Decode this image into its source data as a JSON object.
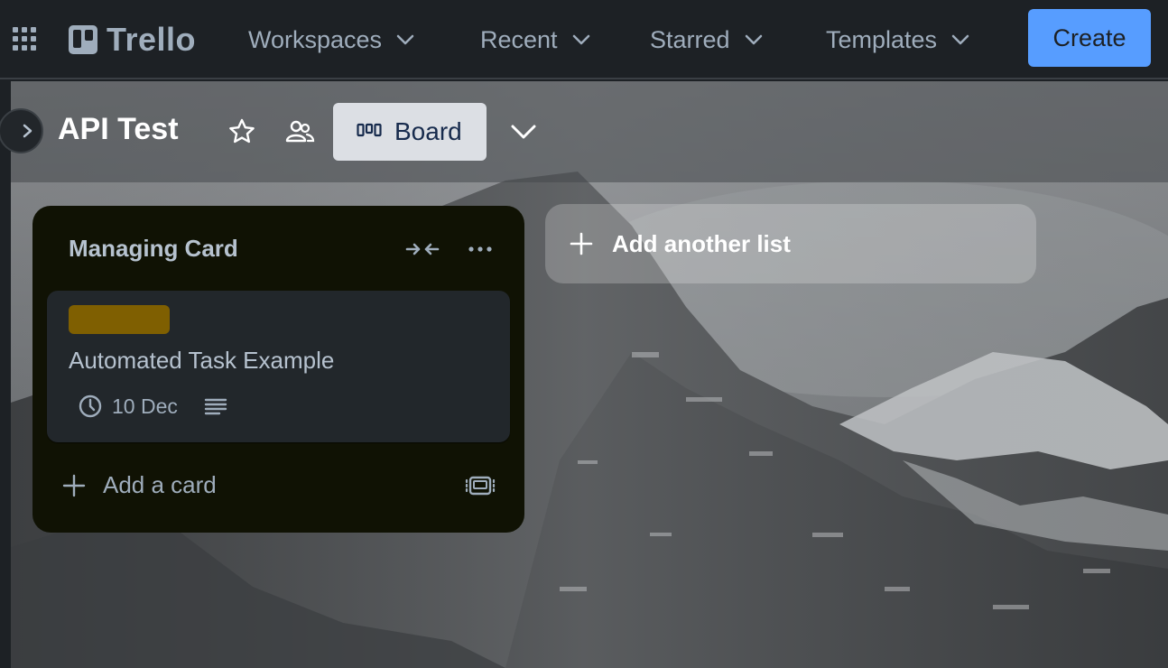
{
  "app": {
    "logo_text": "Trello"
  },
  "nav": {
    "items": [
      {
        "label": "Workspaces"
      },
      {
        "label": "Recent"
      },
      {
        "label": "Starred"
      },
      {
        "label": "Templates"
      }
    ],
    "create_label": "Create"
  },
  "board": {
    "title": "API Test",
    "view_label": "Board",
    "add_list_label": "Add another list",
    "lists": [
      {
        "title": "Managing Card",
        "add_card_label": "Add a card",
        "cards": [
          {
            "title": "Automated Task Example",
            "label_color": "#7f5f01",
            "due": "10 Dec",
            "has_description": true
          }
        ]
      }
    ]
  },
  "colors": {
    "accent": "#579dff",
    "nav_bg": "#1d2125",
    "list_bg": "#101204",
    "card_bg": "#22272b"
  }
}
